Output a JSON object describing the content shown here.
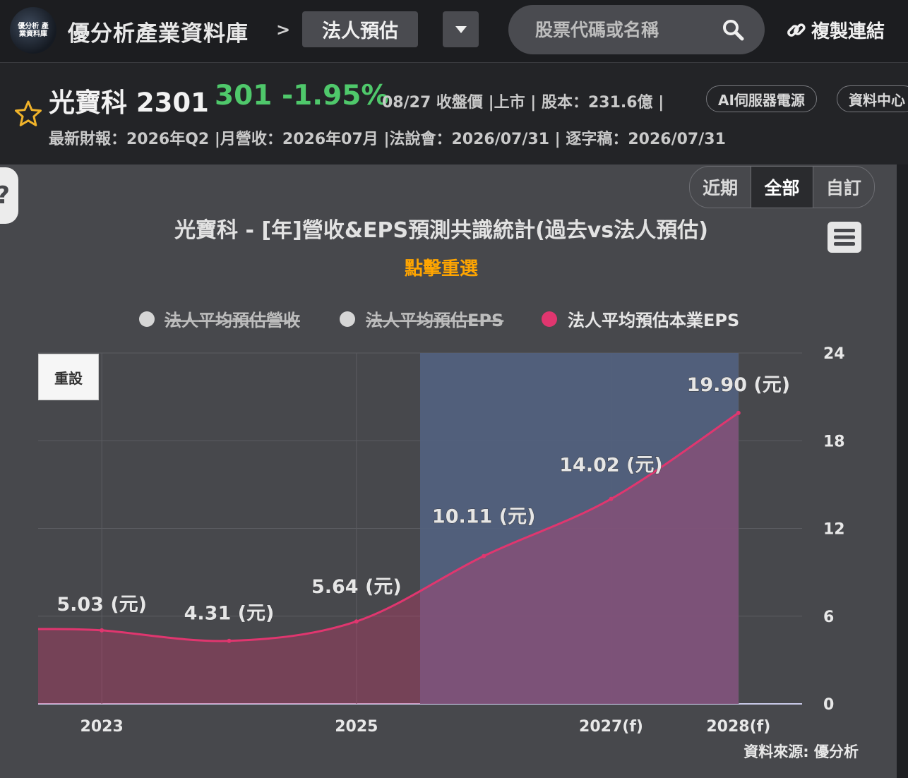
{
  "topbar": {
    "logo_text": "優分析 產業資料庫",
    "site_name": "優分析產業資料庫",
    "separator": ">",
    "page_button": "法人預估",
    "search_placeholder": "股票代碼或名稱",
    "copy_link_label": "複製連結"
  },
  "stock": {
    "name": "光寶科 2301",
    "price": "301 -1.95%",
    "meta": "08/27 收盤價 |上市 | 股本：231.6億 |",
    "tags": [
      "AI伺服器電源",
      "資料中心"
    ],
    "line2": "最新財報：2026年Q2 |月營收：2026年07月 |法說會：2026/07/31 | 逐字稿：2026/07/31"
  },
  "controls": {
    "range_options": [
      "近期",
      "全部",
      "自訂"
    ],
    "range_selected": "全部",
    "reset_label": "重設"
  },
  "colors": {
    "accent_orange": "#ffa500",
    "price_green": "#4fc86b",
    "eps_line": "#e0366f",
    "forecast_band": "#52627f"
  },
  "chart_data": {
    "type": "area",
    "title": "光寶科 - [年]營收&EPS預測共識統計(過去vs法人預估)",
    "subtitle": "點擊重選",
    "legend": [
      {
        "name": "法人平均預估營收",
        "color": "#d6d6d6",
        "visible": false
      },
      {
        "name": "法人平均預估EPS",
        "color": "#d6d6d6",
        "visible": false
      },
      {
        "name": "法人平均預估本業EPS",
        "color": "#e0366f",
        "visible": true
      }
    ],
    "x_tick_labels": [
      "2023",
      "2025",
      "2027(f)",
      "2028(f)"
    ],
    "x_tick_years": [
      2023,
      2025,
      2027,
      2028
    ],
    "x_range": [
      2022.5,
      2028.5
    ],
    "forecast_band": [
      2025.5,
      2028
    ],
    "y_ticks": [
      0,
      6,
      12,
      18,
      24
    ],
    "y_range": [
      0,
      24
    ],
    "grid": true,
    "series": [
      {
        "name": "法人平均預估本業EPS",
        "unit": "元",
        "points": [
          {
            "x": 2023,
            "y": 5.03,
            "label": "5.03 (元)"
          },
          {
            "x": 2024,
            "y": 4.31,
            "label": "4.31 (元)"
          },
          {
            "x": 2025,
            "y": 5.64,
            "label": "5.64 (元)"
          },
          {
            "x": 2026,
            "y": 10.11,
            "label": "10.11 (元)"
          },
          {
            "x": 2027,
            "y": 14.02,
            "label": "14.02 (元)"
          },
          {
            "x": 2028,
            "y": 19.9,
            "label": "19.90 (元)"
          }
        ]
      }
    ],
    "source": "資料來源: 優分析"
  }
}
